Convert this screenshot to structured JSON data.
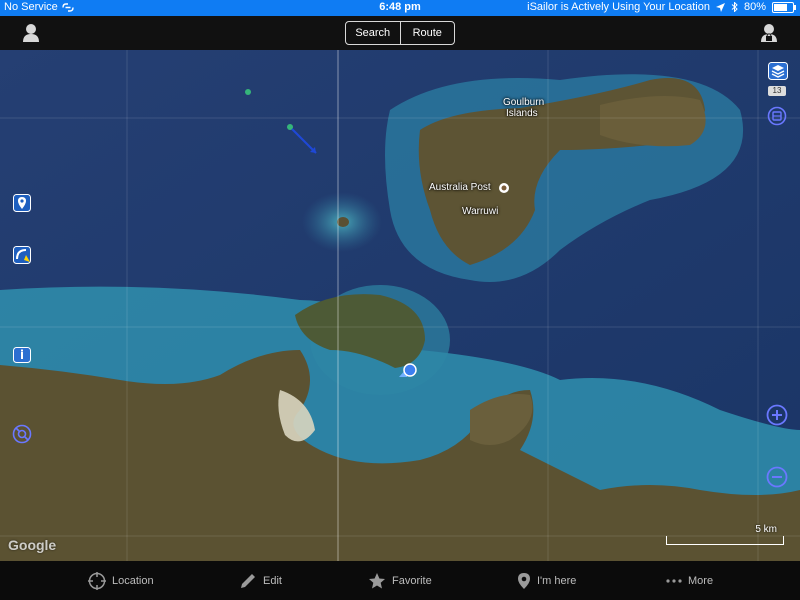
{
  "status": {
    "carrier": "No Service",
    "time": "6:48 pm",
    "location_notice": "iSailor is Actively Using Your Location",
    "battery": "80%",
    "battery_fraction": 0.8
  },
  "toolbar": {
    "search_label": "Search",
    "route_label": "Route"
  },
  "map": {
    "labels": {
      "goulburn_line1": "Goulburn",
      "goulburn_line2": "Islands",
      "australia_post": "Australia Post",
      "warruwi": "Warruwi"
    },
    "layer_badge": "13",
    "google_logo": "Google",
    "scale_label": "5 km"
  },
  "bottom_tabs": [
    {
      "label": "Location",
      "icon": "crosshair-icon"
    },
    {
      "label": "Edit",
      "icon": "pencil-icon"
    },
    {
      "label": "Favorite",
      "icon": "star-icon"
    },
    {
      "label": "I'm here",
      "icon": "map-pin-icon"
    },
    {
      "label": "More",
      "icon": "more-dots-icon"
    }
  ],
  "colors": {
    "status_bar": "#0f7cf3",
    "deep_sea": "#1c3f74",
    "shallow_sea": "#2e8fb0",
    "land": "#5a5133",
    "control_blue": "#6a78ff"
  }
}
